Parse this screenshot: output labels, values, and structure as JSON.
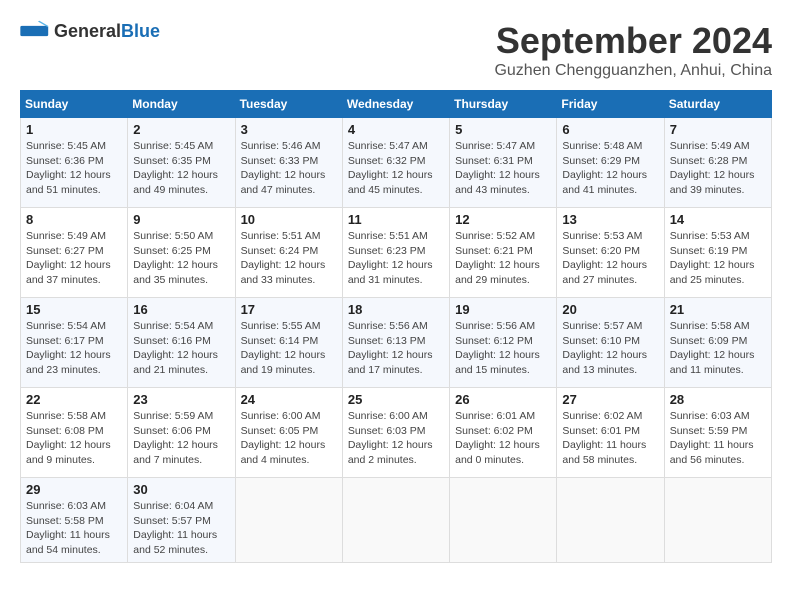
{
  "header": {
    "logo_general": "General",
    "logo_blue": "Blue",
    "month_year": "September 2024",
    "location": "Guzhen Chengguanzhen, Anhui, China"
  },
  "days_of_week": [
    "Sunday",
    "Monday",
    "Tuesday",
    "Wednesday",
    "Thursday",
    "Friday",
    "Saturday"
  ],
  "weeks": [
    [
      {
        "day": 1,
        "info": "Sunrise: 5:45 AM\nSunset: 6:36 PM\nDaylight: 12 hours\nand 51 minutes."
      },
      {
        "day": 2,
        "info": "Sunrise: 5:45 AM\nSunset: 6:35 PM\nDaylight: 12 hours\nand 49 minutes."
      },
      {
        "day": 3,
        "info": "Sunrise: 5:46 AM\nSunset: 6:33 PM\nDaylight: 12 hours\nand 47 minutes."
      },
      {
        "day": 4,
        "info": "Sunrise: 5:47 AM\nSunset: 6:32 PM\nDaylight: 12 hours\nand 45 minutes."
      },
      {
        "day": 5,
        "info": "Sunrise: 5:47 AM\nSunset: 6:31 PM\nDaylight: 12 hours\nand 43 minutes."
      },
      {
        "day": 6,
        "info": "Sunrise: 5:48 AM\nSunset: 6:29 PM\nDaylight: 12 hours\nand 41 minutes."
      },
      {
        "day": 7,
        "info": "Sunrise: 5:49 AM\nSunset: 6:28 PM\nDaylight: 12 hours\nand 39 minutes."
      }
    ],
    [
      {
        "day": 8,
        "info": "Sunrise: 5:49 AM\nSunset: 6:27 PM\nDaylight: 12 hours\nand 37 minutes."
      },
      {
        "day": 9,
        "info": "Sunrise: 5:50 AM\nSunset: 6:25 PM\nDaylight: 12 hours\nand 35 minutes."
      },
      {
        "day": 10,
        "info": "Sunrise: 5:51 AM\nSunset: 6:24 PM\nDaylight: 12 hours\nand 33 minutes."
      },
      {
        "day": 11,
        "info": "Sunrise: 5:51 AM\nSunset: 6:23 PM\nDaylight: 12 hours\nand 31 minutes."
      },
      {
        "day": 12,
        "info": "Sunrise: 5:52 AM\nSunset: 6:21 PM\nDaylight: 12 hours\nand 29 minutes."
      },
      {
        "day": 13,
        "info": "Sunrise: 5:53 AM\nSunset: 6:20 PM\nDaylight: 12 hours\nand 27 minutes."
      },
      {
        "day": 14,
        "info": "Sunrise: 5:53 AM\nSunset: 6:19 PM\nDaylight: 12 hours\nand 25 minutes."
      }
    ],
    [
      {
        "day": 15,
        "info": "Sunrise: 5:54 AM\nSunset: 6:17 PM\nDaylight: 12 hours\nand 23 minutes."
      },
      {
        "day": 16,
        "info": "Sunrise: 5:54 AM\nSunset: 6:16 PM\nDaylight: 12 hours\nand 21 minutes."
      },
      {
        "day": 17,
        "info": "Sunrise: 5:55 AM\nSunset: 6:14 PM\nDaylight: 12 hours\nand 19 minutes."
      },
      {
        "day": 18,
        "info": "Sunrise: 5:56 AM\nSunset: 6:13 PM\nDaylight: 12 hours\nand 17 minutes."
      },
      {
        "day": 19,
        "info": "Sunrise: 5:56 AM\nSunset: 6:12 PM\nDaylight: 12 hours\nand 15 minutes."
      },
      {
        "day": 20,
        "info": "Sunrise: 5:57 AM\nSunset: 6:10 PM\nDaylight: 12 hours\nand 13 minutes."
      },
      {
        "day": 21,
        "info": "Sunrise: 5:58 AM\nSunset: 6:09 PM\nDaylight: 12 hours\nand 11 minutes."
      }
    ],
    [
      {
        "day": 22,
        "info": "Sunrise: 5:58 AM\nSunset: 6:08 PM\nDaylight: 12 hours\nand 9 minutes."
      },
      {
        "day": 23,
        "info": "Sunrise: 5:59 AM\nSunset: 6:06 PM\nDaylight: 12 hours\nand 7 minutes."
      },
      {
        "day": 24,
        "info": "Sunrise: 6:00 AM\nSunset: 6:05 PM\nDaylight: 12 hours\nand 4 minutes."
      },
      {
        "day": 25,
        "info": "Sunrise: 6:00 AM\nSunset: 6:03 PM\nDaylight: 12 hours\nand 2 minutes."
      },
      {
        "day": 26,
        "info": "Sunrise: 6:01 AM\nSunset: 6:02 PM\nDaylight: 12 hours\nand 0 minutes."
      },
      {
        "day": 27,
        "info": "Sunrise: 6:02 AM\nSunset: 6:01 PM\nDaylight: 11 hours\nand 58 minutes."
      },
      {
        "day": 28,
        "info": "Sunrise: 6:03 AM\nSunset: 5:59 PM\nDaylight: 11 hours\nand 56 minutes."
      }
    ],
    [
      {
        "day": 29,
        "info": "Sunrise: 6:03 AM\nSunset: 5:58 PM\nDaylight: 11 hours\nand 54 minutes."
      },
      {
        "day": 30,
        "info": "Sunrise: 6:04 AM\nSunset: 5:57 PM\nDaylight: 11 hours\nand 52 minutes."
      },
      null,
      null,
      null,
      null,
      null
    ]
  ]
}
